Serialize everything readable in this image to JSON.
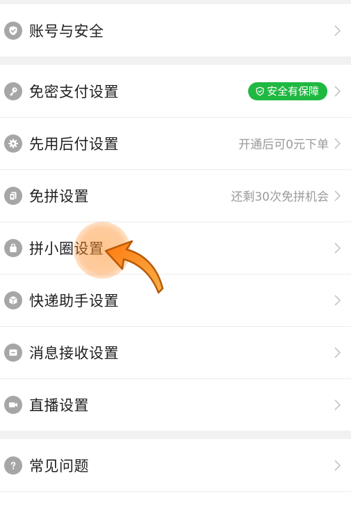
{
  "group1": {
    "items": [
      {
        "icon": "shield-icon",
        "label": "账号与安全"
      }
    ]
  },
  "group2": {
    "items": [
      {
        "icon": "key-icon",
        "label": "免密支付设置",
        "badge": "安全有保障"
      },
      {
        "icon": "gear-icon",
        "label": "先用后付设置",
        "value": "开通后可0元下单"
      },
      {
        "icon": "cards-icon",
        "label": "免拼设置",
        "value": "还剩30次免拼机会"
      },
      {
        "icon": "bag-icon",
        "label": "拼小圈设置"
      },
      {
        "icon": "package-icon",
        "label": "快递助手设置"
      },
      {
        "icon": "message-icon",
        "label": "消息接收设置"
      },
      {
        "icon": "video-camera-icon",
        "label": "直播设置"
      }
    ]
  },
  "group3": {
    "items": [
      {
        "icon": "question-icon",
        "label": "常见问题"
      }
    ]
  },
  "colors": {
    "badge_green": "#1fb841",
    "icon_gray": "#a6a6a6",
    "highlight_orange": "#f28a1c"
  }
}
